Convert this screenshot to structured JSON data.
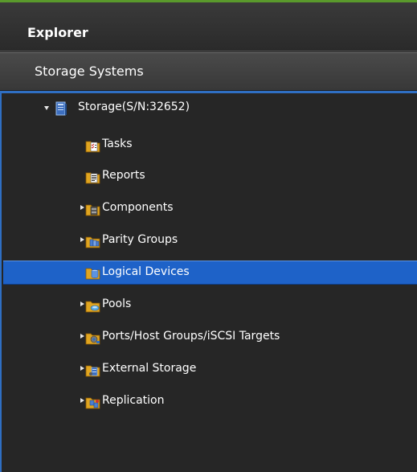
{
  "header": {
    "title": "Explorer"
  },
  "section": {
    "title": "Storage Systems"
  },
  "tree": {
    "root": {
      "label": "Storage(S/N:32652)",
      "icon": "storage-system-icon",
      "expanded": true
    },
    "items": [
      {
        "label": "Tasks",
        "icon": "tasks-folder-icon",
        "expandable": false
      },
      {
        "label": "Reports",
        "icon": "reports-folder-icon",
        "expandable": false
      },
      {
        "label": "Components",
        "icon": "components-folder-icon",
        "expandable": true
      },
      {
        "label": "Parity Groups",
        "icon": "parity-groups-folder-icon",
        "expandable": true
      },
      {
        "label": "Logical Devices",
        "icon": "logical-devices-folder-icon",
        "expandable": false,
        "selected": true
      },
      {
        "label": "Pools",
        "icon": "pools-folder-icon",
        "expandable": true
      },
      {
        "label": "Ports/Host Groups/iSCSI Targets",
        "icon": "ports-folder-icon",
        "expandable": true
      },
      {
        "label": "External Storage",
        "icon": "external-storage-folder-icon",
        "expandable": true
      },
      {
        "label": "Replication",
        "icon": "replication-folder-icon",
        "expandable": true
      }
    ]
  },
  "colors": {
    "accent": "#5a9a2c",
    "selection": "#1e62c8",
    "border": "#2f6fc3",
    "background": "#262626"
  }
}
